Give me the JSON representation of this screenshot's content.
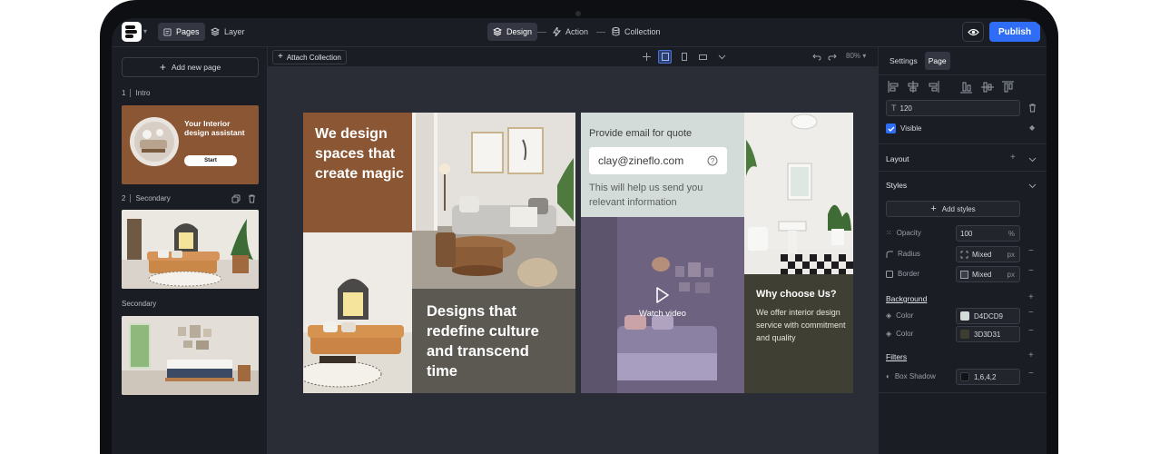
{
  "topbar": {
    "pages_label": "Pages",
    "layer_label": "Layer",
    "design_label": "Design",
    "action_label": "Action",
    "collection_label": "Collection",
    "publish_label": "Publish"
  },
  "left_panel": {
    "add_page_label": "Add new page",
    "pages": [
      {
        "number": "1",
        "name": "Intro",
        "thumb_title": "Your Interior design assistant",
        "thumb_button": "Start"
      },
      {
        "number": "2",
        "name": "Secondary"
      },
      {
        "number": "",
        "name": "Secondary"
      }
    ]
  },
  "canvas_bar": {
    "attach_label": "Attach Collection",
    "zoom": "80%"
  },
  "artboard": {
    "headline_1": "We design spaces that create magic",
    "headline_2": "Designs that redefine culture and transcend time",
    "quote_title": "Provide email for quote",
    "email_value": "clay@zineflo.com",
    "email_note": "This will help us send you relevant information",
    "watch_video": "Watch video",
    "why_title": "Why choose Us?",
    "why_body": "We offer interior design service with commitment and quality"
  },
  "right_panel": {
    "tab_settings": "Settings",
    "tab_page": "Page",
    "text_value": "120",
    "visible_label": "Visible",
    "layout_label": "Layout",
    "styles_label": "Styles",
    "add_styles_label": "Add styles",
    "opacity_label": "Opacity",
    "opacity_value": "100",
    "opacity_unit": "%",
    "radius_label": "Radius",
    "radius_value": "Mixed",
    "radius_unit": "px",
    "border_label": "Border",
    "border_value": "Mixed",
    "border_unit": "px",
    "background_label": "Background",
    "color_label_1": "Color",
    "color_value_1": "D4DCD9",
    "color_label_2": "Color",
    "color_value_2": "3D3D31",
    "filters_label": "Filters",
    "box_shadow_label": "Box Shadow",
    "box_shadow_value": "1,6,4,2"
  },
  "colors": {
    "accent": "#2f6df6",
    "brown": "#8a5634",
    "grey_block": "#5b5952",
    "dark_block": "#403f33",
    "swatch_1": "#D4DCD9",
    "swatch_2": "#3D3D31"
  },
  "icons": [
    "logo-icon",
    "pages-icon",
    "layer-icon",
    "design-icon",
    "action-icon",
    "collection-icon",
    "eye-icon",
    "plus-icon",
    "play-icon",
    "help-icon",
    "trash-icon",
    "copy-icon",
    "undo-icon",
    "redo-icon",
    "chevron-down-icon"
  ]
}
